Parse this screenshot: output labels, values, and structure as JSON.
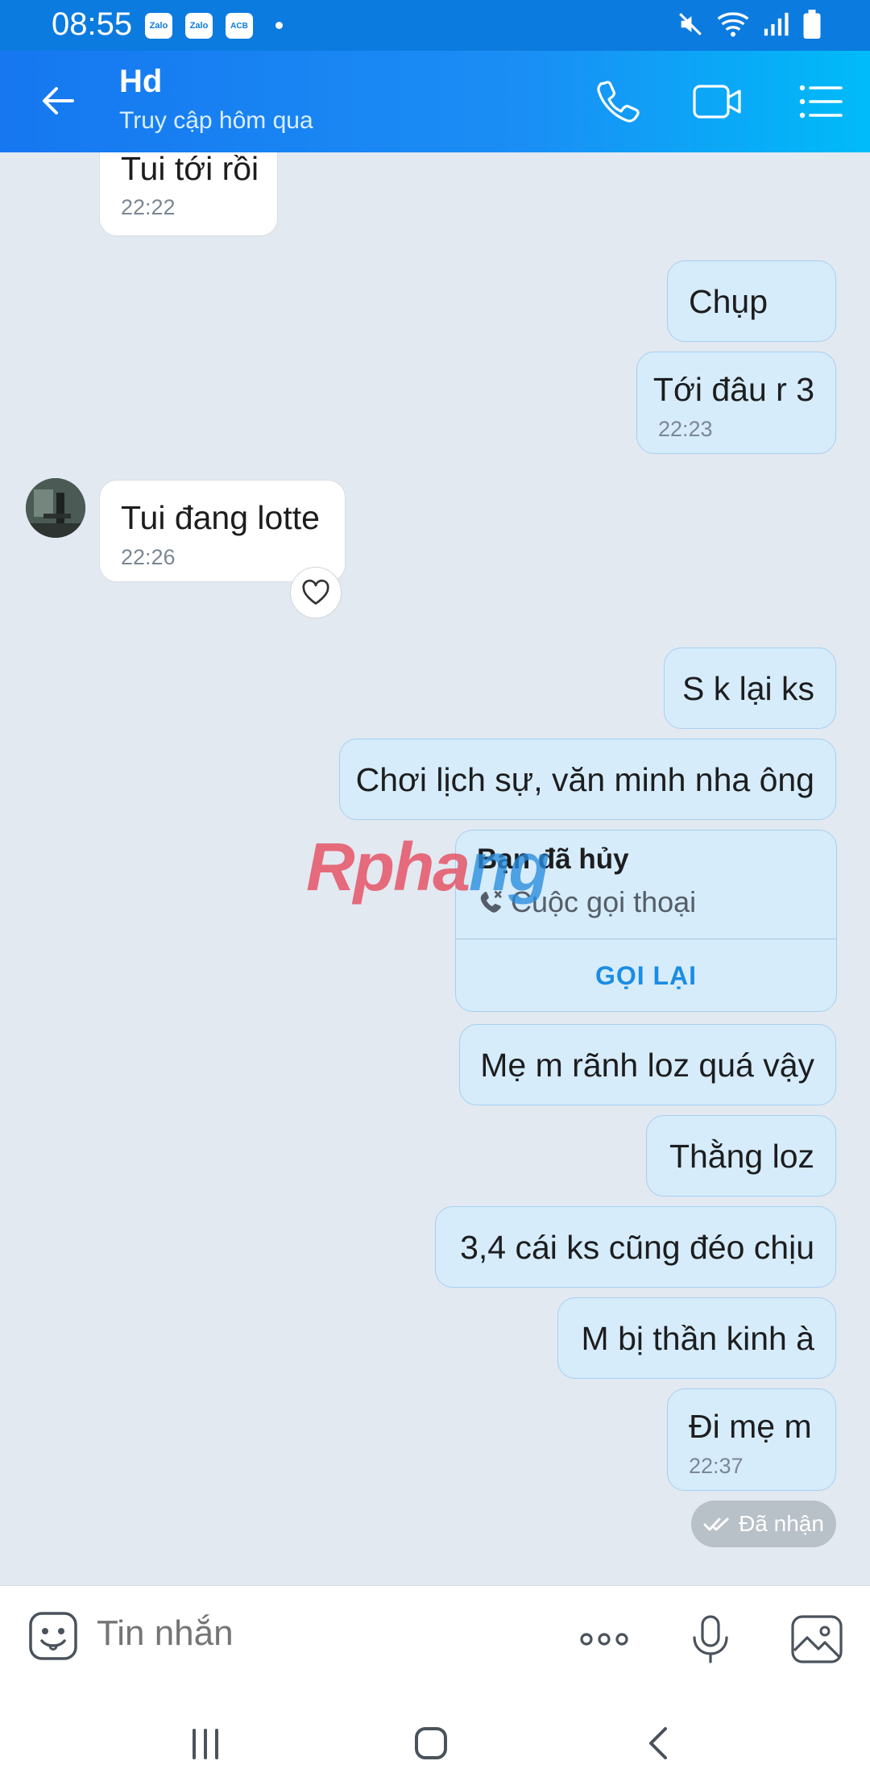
{
  "status_bar": {
    "time": "08:55",
    "notifications": [
      "Zalo",
      "Zalo",
      "ACB"
    ]
  },
  "header": {
    "contact_name": "Hd",
    "status": "Truy cập hôm qua"
  },
  "messages": [
    {
      "text": "Tui tới rồi",
      "time": "22:22",
      "direction": "in"
    },
    {
      "text": "Chụp",
      "direction": "out"
    },
    {
      "text": "Tới đâu r 3",
      "time": "22:23",
      "direction": "out"
    },
    {
      "text": "Tui đang lotte",
      "time": "22:26",
      "direction": "in"
    },
    {
      "text": "S k lại ks",
      "direction": "out"
    },
    {
      "text": "Chơi lịch sự, văn minh nha ông",
      "direction": "out"
    },
    {
      "text": "Mẹ m rãnh loz quá vậy",
      "direction": "out"
    },
    {
      "text": "Thằng loz",
      "direction": "out"
    },
    {
      "text": "3,4 cái ks cũng đéo chịu",
      "direction": "out"
    },
    {
      "text": "M bị thần kinh à",
      "direction": "out"
    },
    {
      "text": "Đi mẹ m",
      "time": "22:37",
      "direction": "out"
    }
  ],
  "call_card": {
    "title": "Bạn đã hủy",
    "subtitle": "Cuộc gọi thoại",
    "action": "GỌI LẠI"
  },
  "watermark": {
    "part1": "Rpha",
    "part2": "ng"
  },
  "delivery_status": "Đã nhận",
  "input": {
    "placeholder": "Tin nhắn"
  },
  "colors": {
    "header_start": "#1677f0",
    "header_end": "#00bbf9",
    "outgoing_bubble": "#d6ecfb",
    "incoming_bubble": "#ffffff",
    "chat_background": "#e2e9f1",
    "accent": "#1a8de2"
  }
}
